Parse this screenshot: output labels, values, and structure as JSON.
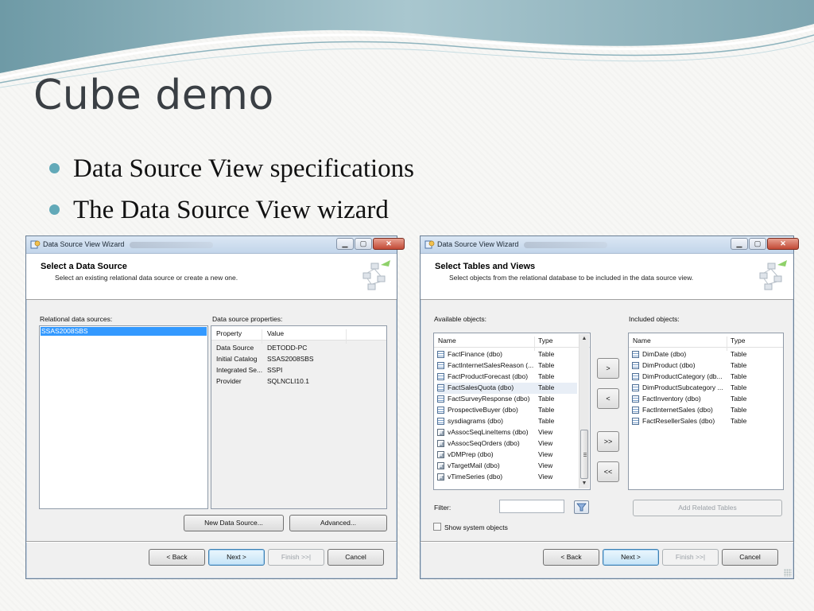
{
  "slide": {
    "title": "Cube demo",
    "bullets": [
      "Data Source View specifications",
      "The Data Source View wizard"
    ],
    "accent_color": "#62a9b8"
  },
  "left_window": {
    "title": "Data Source View Wizard",
    "header_title": "Select a Data Source",
    "header_subtitle": "Select an existing relational data source or create a new one.",
    "relational_label": "Relational data sources:",
    "selected_source": "SSAS2008SBS",
    "properties_label": "Data source properties:",
    "grid_headers": {
      "property": "Property",
      "value": "Value"
    },
    "properties": [
      {
        "property": "Data Source",
        "value": "DETODD-PC"
      },
      {
        "property": "Initial Catalog",
        "value": "SSAS2008SBS"
      },
      {
        "property": "Integrated Se...",
        "value": "SSPI"
      },
      {
        "property": "Provider",
        "value": "SQLNCLI10.1"
      }
    ],
    "buttons": {
      "new_data_source": "New Data Source...",
      "advanced": "Advanced...",
      "back": "< Back",
      "next": "Next >",
      "finish": "Finish >>|",
      "cancel": "Cancel"
    }
  },
  "right_window": {
    "title": "Data Source View Wizard",
    "header_title": "Select Tables and Views",
    "header_subtitle": "Select objects from the relational database to be included in the data source view.",
    "available_label": "Available objects:",
    "included_label": "Included objects:",
    "col_headers": {
      "name": "Name",
      "type": "Type"
    },
    "available_objects": [
      {
        "name": "FactFinance (dbo)",
        "type": "Table",
        "kind": "table-icon"
      },
      {
        "name": "FactInternetSalesReason (...",
        "type": "Table",
        "kind": "table-icon"
      },
      {
        "name": "FactProductForecast (dbo)",
        "type": "Table",
        "kind": "table-icon"
      },
      {
        "name": "FactSalesQuota (dbo)",
        "type": "Table",
        "kind": "table-icon"
      },
      {
        "name": "FactSurveyResponse (dbo)",
        "type": "Table",
        "kind": "table-icon"
      },
      {
        "name": "ProspectiveBuyer (dbo)",
        "type": "Table",
        "kind": "table-icon"
      },
      {
        "name": "sysdiagrams (dbo)",
        "type": "Table",
        "kind": "table-icon"
      },
      {
        "name": "vAssocSeqLineItems (dbo)",
        "type": "View",
        "kind": "view-icon"
      },
      {
        "name": "vAssocSeqOrders (dbo)",
        "type": "View",
        "kind": "view-icon"
      },
      {
        "name": "vDMPrep (dbo)",
        "type": "View",
        "kind": "view-icon"
      },
      {
        "name": "vTargetMail (dbo)",
        "type": "View",
        "kind": "view-icon"
      },
      {
        "name": "vTimeSeries (dbo)",
        "type": "View",
        "kind": "view-icon"
      }
    ],
    "highlighted_index": 3,
    "included_objects": [
      {
        "name": "DimDate (dbo)",
        "type": "Table"
      },
      {
        "name": "DimProduct (dbo)",
        "type": "Table"
      },
      {
        "name": "DimProductCategory (db...",
        "type": "Table"
      },
      {
        "name": "DimProductSubcategory ...",
        "type": "Table"
      },
      {
        "name": "FactInventory (dbo)",
        "type": "Table"
      },
      {
        "name": "FactInternetSales (dbo)",
        "type": "Table"
      },
      {
        "name": "FactResellerSales (dbo)",
        "type": "Table"
      }
    ],
    "move_buttons": {
      "add": ">",
      "remove": "<",
      "add_all": ">>",
      "remove_all": "<<"
    },
    "filter_label": "Filter:",
    "filter_value": "",
    "add_related": "Add Related Tables",
    "show_system": "Show system objects",
    "buttons": {
      "back": "< Back",
      "next": "Next >",
      "finish": "Finish >>|",
      "cancel": "Cancel"
    }
  }
}
